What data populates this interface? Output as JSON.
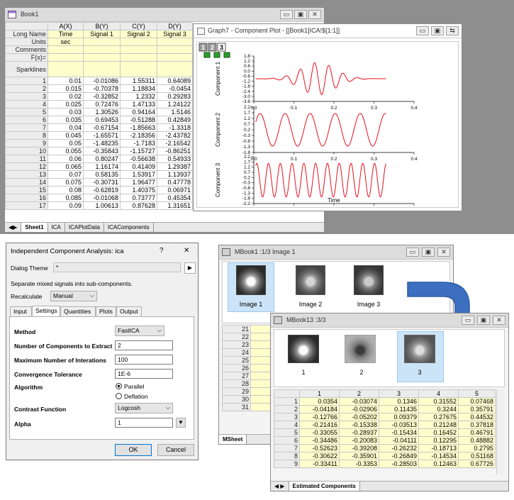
{
  "book1": {
    "title": "Book1",
    "col_headers": [
      "A(X)",
      "B(Y)",
      "C(Y)",
      "D(Y)"
    ],
    "meta_rows": [
      {
        "label": "Long Name",
        "cells": [
          "Time",
          "Signal 1",
          "Signal 2",
          "Signal 3"
        ]
      },
      {
        "label": "Units",
        "cells": [
          "sec",
          "",
          "",
          ""
        ]
      },
      {
        "label": "Comments",
        "cells": [
          "",
          "",
          "",
          ""
        ]
      },
      {
        "label": "F(x)=",
        "cells": [
          "",
          "",
          "",
          ""
        ]
      },
      {
        "label": "Sparklines",
        "cells": [
          "",
          "",
          "",
          ""
        ]
      }
    ],
    "rows": [
      [
        "1",
        "0.01",
        "-0.01086",
        "1.55311",
        "0.64089"
      ],
      [
        "2",
        "0.015",
        "-0.70378",
        "1.18834",
        "-0.0454"
      ],
      [
        "3",
        "0.02",
        "-0.32852",
        "1.2332",
        "0.29283"
      ],
      [
        "4",
        "0.025",
        "0.72476",
        "1.47133",
        "1.24122"
      ],
      [
        "5",
        "0.03",
        "1.30526",
        "0.94164",
        "1.5146"
      ],
      [
        "6",
        "0.035",
        "0.69453",
        "-0.51288",
        "0.42849"
      ],
      [
        "7",
        "0.04",
        "-0.67154",
        "-1.85663",
        "-1.3318"
      ],
      [
        "8",
        "0.045",
        "-1.65571",
        "-2.18356",
        "-2.43782"
      ],
      [
        "9",
        "0.05",
        "-1.48235",
        "-1.7183",
        "-2.16542"
      ],
      [
        "10",
        "0.055",
        "-0.35843",
        "-1.15727",
        "-0.86251"
      ],
      [
        "11",
        "0.06",
        "0.80247",
        "-0.56638",
        "0.54933"
      ],
      [
        "12",
        "0.065",
        "1.16174",
        "0.41409",
        "1.29387"
      ],
      [
        "13",
        "0.07",
        "0.58135",
        "1.53917",
        "1.13937"
      ],
      [
        "14",
        "0.075",
        "-0.30731",
        "1.96477",
        "0.47778"
      ],
      [
        "15",
        "0.08",
        "-0.62819",
        "1.40375",
        "0.06971"
      ],
      [
        "16",
        "0.085",
        "-0.01068",
        "0.73777",
        "0.45354"
      ],
      [
        "17",
        "0.09",
        "1.00613",
        "0.87628",
        "1.31651"
      ]
    ],
    "tabs": [
      "Sheet1",
      "ICA",
      "ICAPlotData",
      "ICAComponents"
    ]
  },
  "graph7": {
    "title": "Graph7 - Component Plot - [[Book1]ICA!$[1:1]]",
    "layers": [
      "1",
      "2",
      "3"
    ],
    "xlabel": "Time",
    "panels": [
      {
        "ylabel": "Component 1",
        "yticks": [
          "1.8",
          "1.2",
          "0.6",
          "0.0",
          "-0.6",
          "-1.2",
          "-1.8",
          "-2.4",
          "-3.0",
          "-3.6"
        ]
      },
      {
        "ylabel": "Component 2",
        "yticks": [
          "2.2",
          "1.7",
          "1.2",
          "0.7",
          "0.2",
          "-0.3",
          "-0.8",
          "-1.3",
          "-1.8"
        ]
      },
      {
        "ylabel": "Component 3",
        "yticks": [
          "2.2",
          "1.7",
          "1.2",
          "0.7",
          "0.2",
          "-0.3",
          "-0.8",
          "-1.3",
          "-1.8",
          "-2.2"
        ]
      }
    ],
    "xticks": [
      "0.0",
      "0.1",
      "0.2",
      "0.3",
      "0.4"
    ],
    "line_color": "#e8101c"
  },
  "dialog": {
    "title": "Independent Component Analysis: ica",
    "help": "?",
    "close": "✕",
    "theme_label": "Dialog Theme",
    "theme_value": "*",
    "description": "Separate mixed signals into sub-components.",
    "recalc_label": "Recalculate",
    "recalc_value": "Manual",
    "tabs": [
      "Input",
      "Settings",
      "Quantities",
      "Plots",
      "Output"
    ],
    "method_label": "Method",
    "method_value": "FastICA",
    "ncomp_label": "Number of Components to Extract",
    "ncomp_value": "2",
    "maxiter_label": "Maximum Number of Interations",
    "maxiter_value": "100",
    "tol_label": "Convergence Tolerance",
    "tol_value": "1E-6",
    "algo_label": "Algorithm",
    "algo_opt1": "Parallel",
    "algo_opt2": "Deflation",
    "contrast_label": "Contrast Function",
    "contrast_value": "Logcosh",
    "alpha_label": "Alpha",
    "alpha_value": "1",
    "ok": "OK",
    "cancel": "Cancel"
  },
  "mbook1": {
    "title": "MBook1 :1/3 Image 1",
    "images": [
      "Image 1",
      "Image 2",
      "Image 3"
    ],
    "rows": [
      "21",
      "22",
      "23",
      "24",
      "25",
      "26",
      "27",
      "28",
      "29",
      "30",
      "31"
    ],
    "tab": "MSheet"
  },
  "mbook13": {
    "title": "MBook13 :3/3",
    "images": [
      "1",
      "2",
      "3"
    ],
    "col_headers": [
      "1",
      "2",
      "3",
      "4",
      "5"
    ],
    "rows": [
      [
        "1",
        "0.0354",
        "-0.03074",
        "0.1346",
        "0.31552",
        "0.07468"
      ],
      [
        "2",
        "-0.04184",
        "-0.02906",
        "0.11435",
        "0.3244",
        "0.35791"
      ],
      [
        "3",
        "-0.12766",
        "-0.05202",
        "0.09379",
        "0.27675",
        "0.44532"
      ],
      [
        "4",
        "-0.21416",
        "-0.15338",
        "-0.03513",
        "0.21248",
        "0.37818"
      ],
      [
        "5",
        "-0.33055",
        "-0.28937",
        "-0.15434",
        "0.16452",
        "0.46791"
      ],
      [
        "6",
        "-0.34486",
        "-0.20083",
        "-0.04111",
        "0.12295",
        "0.48882"
      ],
      [
        "7",
        "-0.52623",
        "-0.39208",
        "-0.26232",
        "-0.18713",
        "0.2795"
      ],
      [
        "8",
        "-0.30622",
        "-0.35901",
        "-0.26849",
        "-0.14534",
        "0.51168"
      ],
      [
        "9",
        "-0.33411",
        "-0.3353",
        "-0.28503",
        "0.12463",
        "0.67726"
      ]
    ],
    "tab": "Estimated Components"
  },
  "arrow_color": "#3c6fc0"
}
